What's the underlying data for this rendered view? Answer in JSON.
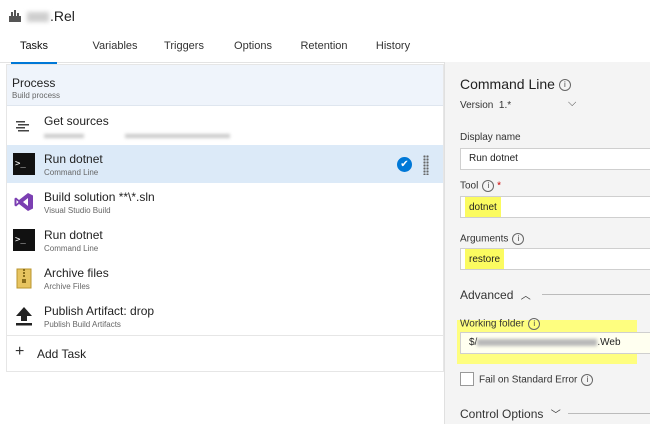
{
  "pipeline": {
    "title": ".Rel",
    "icon": "build-pipeline-icon"
  },
  "tabs": [
    "Tasks",
    "Variables",
    "Triggers",
    "Options",
    "Retention",
    "History"
  ],
  "process": {
    "title": "Process",
    "subtitle": "Build process"
  },
  "tasks": [
    {
      "name": "Get sources",
      "subtitle": "",
      "icon": "get-sources-icon"
    },
    {
      "name": "Run dotnet",
      "subtitle": "Command Line",
      "icon": "command-line-icon"
    },
    {
      "name": "Build solution **\\*.sln",
      "subtitle": "Visual Studio Build",
      "icon": "visual-studio-icon"
    },
    {
      "name": "Run dotnet",
      "subtitle": "Command Line",
      "icon": "command-line-icon"
    },
    {
      "name": "Archive files",
      "subtitle": "Archive Files",
      "icon": "archive-icon"
    },
    {
      "name": "Publish Artifact: drop",
      "subtitle": "Publish Build Artifacts",
      "icon": "upload-icon"
    }
  ],
  "add_task": "Add Task",
  "details": {
    "title": "Command Line",
    "version_label": "Version",
    "version_value": "1.*",
    "display_name_label": "Display name",
    "display_name_value": "Run dotnet",
    "tool_label": "Tool",
    "tool_value": "dotnet",
    "arguments_label": "Arguments",
    "arguments_value": "restore",
    "advanced_label": "Advanced",
    "working_folder_label": "Working folder",
    "working_folder_value": "$/",
    "working_folder_suffix": ".Web",
    "fail_label": "Fail on Standard Error",
    "control_options_label": "Control Options"
  },
  "colors": {
    "accent": "#0078d7",
    "highlight": "#ffff6a",
    "selected_row": "#dceaf8"
  }
}
